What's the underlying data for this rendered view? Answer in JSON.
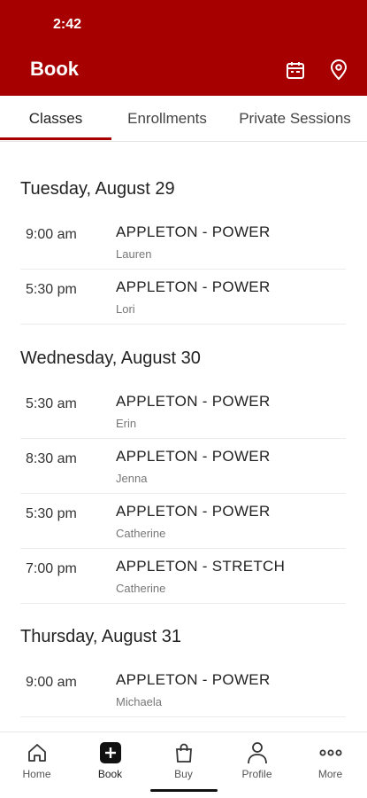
{
  "status_bar": {
    "time": "2:42"
  },
  "header": {
    "title": "Book",
    "calendar_icon": "calendar-icon",
    "location_icon": "map-pin-icon",
    "background": "#a60000"
  },
  "tabs": [
    {
      "label": "Classes",
      "active": true
    },
    {
      "label": "Enrollments",
      "active": false
    },
    {
      "label": "Private Sessions",
      "active": false
    }
  ],
  "schedule": [
    {
      "date": "Tuesday, August 29",
      "classes": [
        {
          "time": "9:00 am",
          "name": "APPLETON - POWER",
          "instructor": "Lauren"
        },
        {
          "time": "5:30 pm",
          "name": "APPLETON - POWER",
          "instructor": "Lori"
        }
      ]
    },
    {
      "date": "Wednesday, August 30",
      "classes": [
        {
          "time": "5:30 am",
          "name": "APPLETON - POWER",
          "instructor": "Erin"
        },
        {
          "time": "8:30 am",
          "name": "APPLETON - POWER",
          "instructor": "Jenna"
        },
        {
          "time": "5:30 pm",
          "name": "APPLETON - POWER",
          "instructor": "Catherine"
        },
        {
          "time": "7:00 pm",
          "name": "APPLETON - STRETCH",
          "instructor": "Catherine"
        }
      ]
    },
    {
      "date": "Thursday, August 31",
      "classes": [
        {
          "time": "9:00 am",
          "name": "APPLETON - POWER",
          "instructor": "Michaela"
        }
      ]
    }
  ],
  "bottom_nav": [
    {
      "label": "Home",
      "icon": "home-icon"
    },
    {
      "label": "Book",
      "icon": "plus-square-icon",
      "active": true
    },
    {
      "label": "Buy",
      "icon": "shopping-bag-icon"
    },
    {
      "label": "Profile",
      "icon": "person-icon"
    },
    {
      "label": "More",
      "icon": "more-dots-icon"
    }
  ]
}
